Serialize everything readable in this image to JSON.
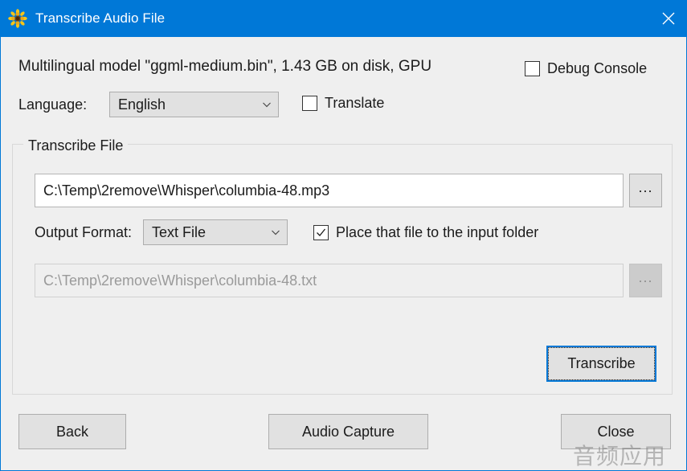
{
  "window": {
    "title": "Transcribe Audio File",
    "icon": "sunflower-icon",
    "close_icon": "close-icon",
    "titlebar_color": "#0078d7",
    "background_color": "#efefef",
    "accent_color": "#0078d7"
  },
  "header": {
    "model_info": "Multilingual model \"ggml-medium.bin\", 1.43 GB on disk, GPU",
    "debug_console": {
      "label": "Debug Console",
      "checked": false
    }
  },
  "language_row": {
    "label": "Language:",
    "selected": "English",
    "options": [
      "English"
    ],
    "translate": {
      "label": "Translate",
      "checked": false
    }
  },
  "transcribe_group": {
    "legend": "Transcribe File",
    "input_file": {
      "value": "C:\\Temp\\2remove\\Whisper\\columbia-48.mp3",
      "browse_label": "..."
    },
    "output_format": {
      "label": "Output Format:",
      "selected": "Text File",
      "options": [
        "Text File"
      ]
    },
    "place_in_input_folder": {
      "label": "Place that file to the input folder",
      "checked": true
    },
    "output_file": {
      "value": "C:\\Temp\\2remove\\Whisper\\columbia-48.txt",
      "browse_label": "...",
      "disabled": true
    },
    "transcribe_button": {
      "label": "Transcribe",
      "focused": true
    }
  },
  "footer": {
    "back_label": "Back",
    "audio_capture_label": "Audio Capture",
    "close_label": "Close"
  },
  "watermark": {
    "text": "音频应用"
  }
}
